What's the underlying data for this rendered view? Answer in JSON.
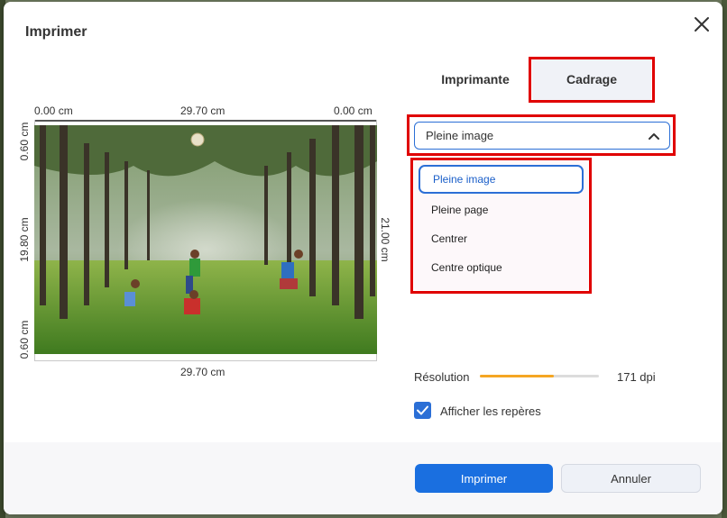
{
  "dialog": {
    "title": "Imprimer"
  },
  "preview": {
    "top_left": "0.00 cm",
    "top_center": "29.70 cm",
    "top_right": "0.00 cm",
    "left_top": "0.60 cm",
    "left_middle": "19.80 cm",
    "left_bottom": "0.60 cm",
    "right_middle": "21.00 cm",
    "bottom_center": "29.70 cm"
  },
  "tabs": [
    {
      "label": "Imprimante"
    },
    {
      "label": "Cadrage"
    }
  ],
  "cadrage": {
    "selected": "Pleine image",
    "options": [
      "Pleine image",
      "Pleine page",
      "Centrer",
      "Centre optique"
    ]
  },
  "resolution": {
    "label": "Résolution",
    "value": "171 dpi",
    "level_fraction": 0.62
  },
  "checkbox": {
    "label": "Afficher les repères",
    "checked": true
  },
  "buttons": {
    "print": "Imprimer",
    "cancel": "Annuler"
  },
  "colors": {
    "accent": "#1a6fe0",
    "highlight": "#e00000",
    "slider": "#f5a623"
  }
}
